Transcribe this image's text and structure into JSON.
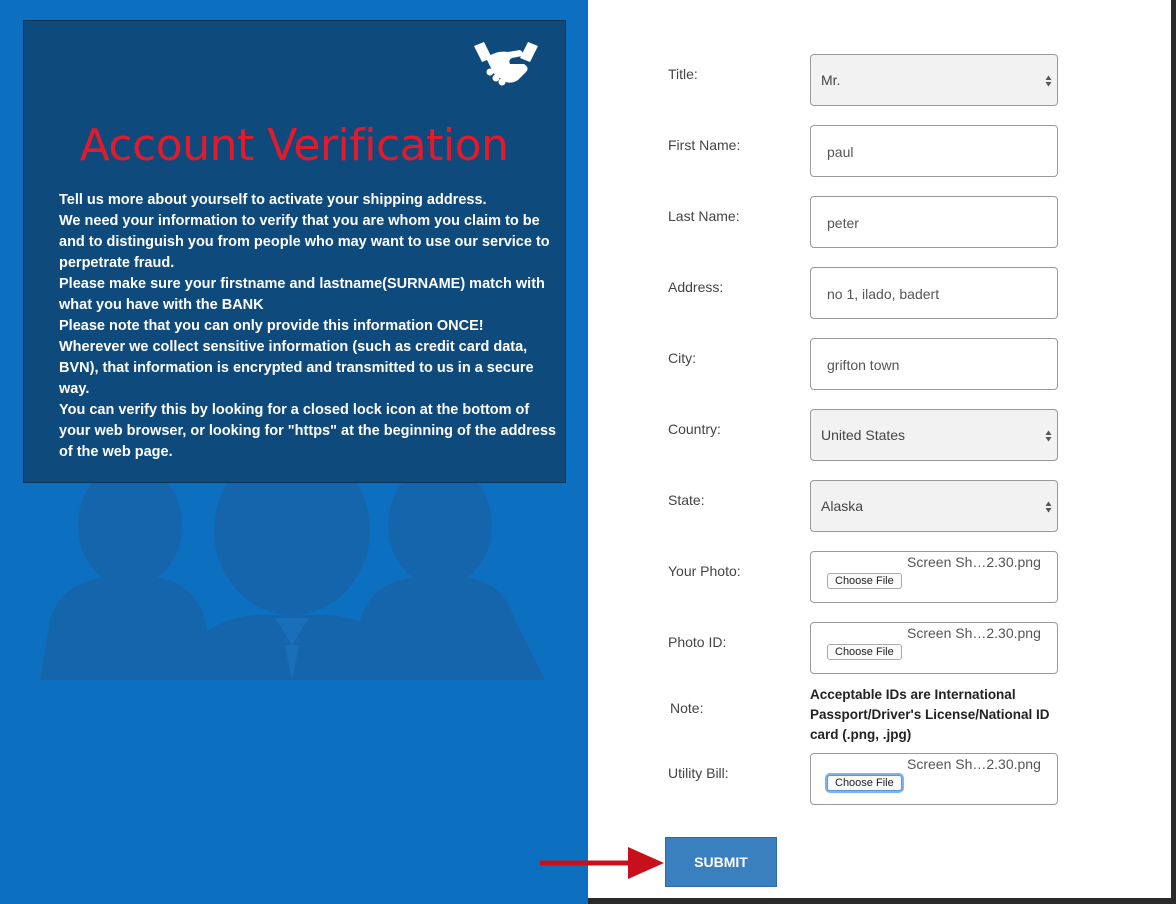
{
  "left": {
    "title": "Account Verification",
    "paragraphs": [
      "Tell us more about yourself to activate your shipping address.",
      "We need your information to verify that you are whom you claim to be and to distinguish you from people who may want to use our service to perpetrate fraud.",
      "Please make sure your firstname and lastname(SURNAME) match with what you have with the BANK",
      "Please note that you can only provide this information ONCE!",
      "Wherever we collect sensitive information (such as credit card data, BVN), that information is encrypted and transmitted to us in a secure way.",
      "You can verify this by looking for a closed lock icon at the bottom of your web browser, or looking for \"https\" at the beginning of the address of the web page."
    ],
    "title_color": "#e21a2b",
    "panel_color": "#0d6fbf",
    "box_color": "#0f4a7d",
    "logo_icon": "handshake-icon",
    "background_icon": "people-silhouette-icon"
  },
  "form": {
    "title": {
      "label": "Title:",
      "value": "Mr."
    },
    "first_name": {
      "label": "First Name:",
      "value": "paul"
    },
    "last_name": {
      "label": "Last Name:",
      "value": "peter"
    },
    "address": {
      "label": "Address:",
      "value": "no 1, ilado, badert"
    },
    "city": {
      "label": "City:",
      "value": "grifton town"
    },
    "country": {
      "label": "Country:",
      "value": "United States"
    },
    "state": {
      "label": "State:",
      "value": "Alaska"
    },
    "photo": {
      "label": "Your Photo:",
      "button": "Choose File",
      "file": "Screen Sh…2.30.png"
    },
    "photo_id": {
      "label": "Photo ID:",
      "button": "Choose File",
      "file": "Screen Sh…2.30.png"
    },
    "note": {
      "label": "Note:",
      "text": "Acceptable IDs are International Passport/Driver's License/National ID card (.png, .jpg)"
    },
    "utility_bill": {
      "label": "Utility Bill:",
      "button": "Choose File",
      "file": "Screen Sh…2.30.png"
    },
    "submit": "SUBMIT"
  },
  "annotation": {
    "arrow_color": "#c8101c"
  }
}
